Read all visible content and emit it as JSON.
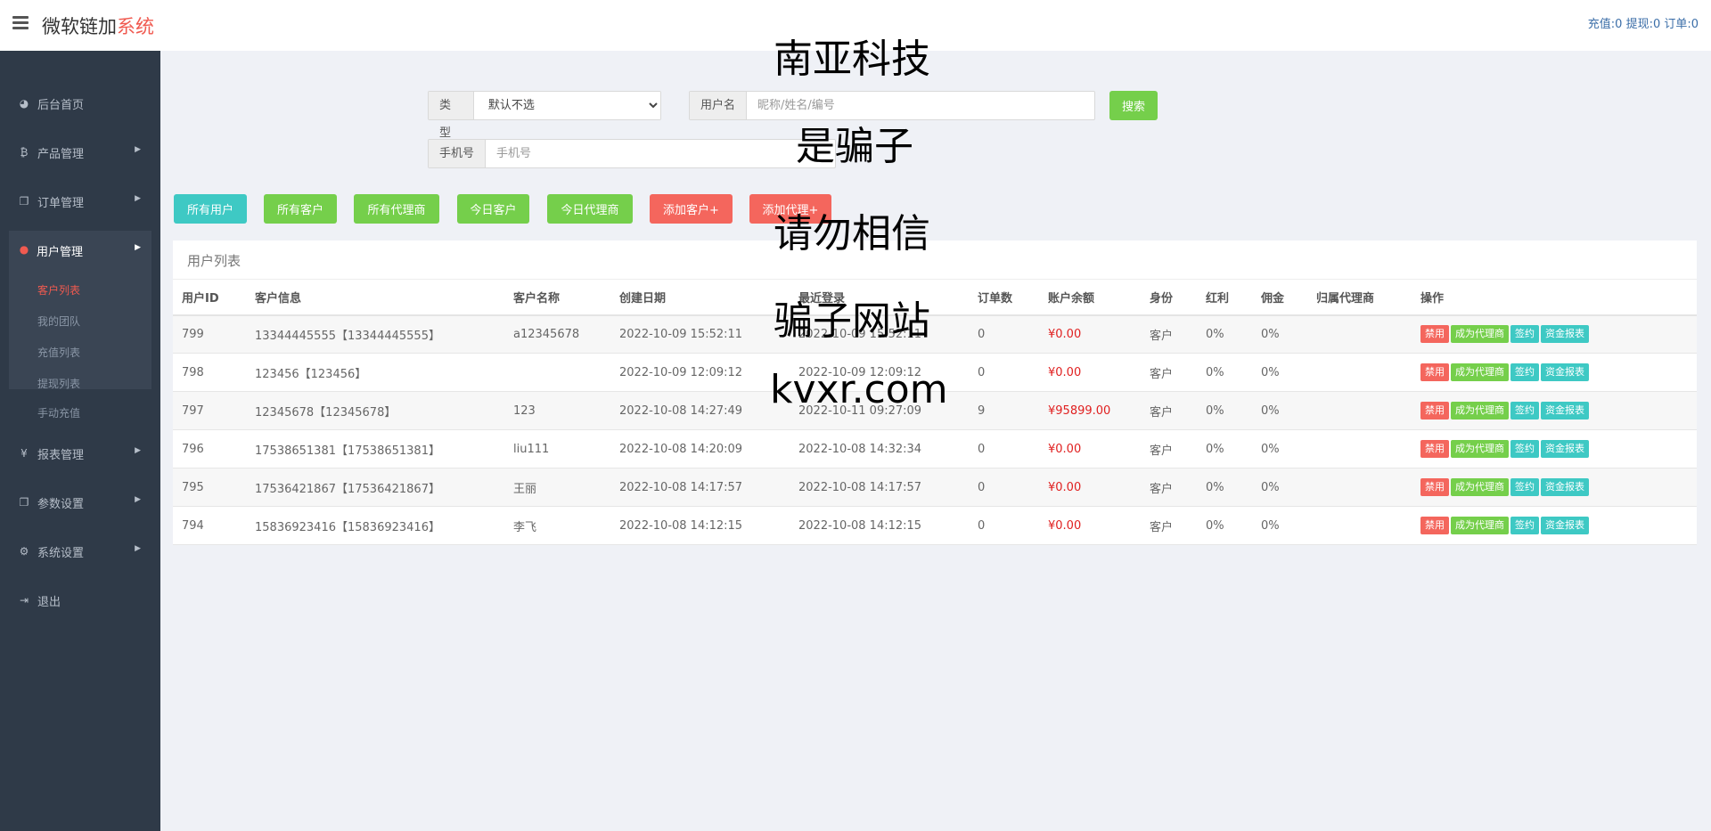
{
  "header": {
    "logo_main": "微软链加",
    "logo_accent": "系统",
    "stats": "充值:0 提现:0 订单:0"
  },
  "sidebar": {
    "items": [
      {
        "label": "后台首页",
        "icon": "dashboard-icon",
        "glyph": "◕"
      },
      {
        "label": "产品管理",
        "icon": "bitcoin-icon",
        "glyph": "₿"
      },
      {
        "label": "订单管理",
        "icon": "copy-icon",
        "glyph": "❐"
      },
      {
        "label": "用户管理",
        "icon": "user-icon",
        "glyph": "👤"
      },
      {
        "label": "报表管理",
        "icon": "yen-icon",
        "glyph": "¥"
      },
      {
        "label": "参数设置",
        "icon": "files-icon",
        "glyph": "❐"
      },
      {
        "label": "系统设置",
        "icon": "gears-icon",
        "glyph": "⚙"
      },
      {
        "label": "退出",
        "icon": "sign-out-icon",
        "glyph": "⇥"
      }
    ],
    "submenu": [
      "客户列表",
      "我的团队",
      "充值列表",
      "提现列表",
      "手动充值"
    ]
  },
  "search": {
    "type_label": "类型",
    "type_selected": "默认不选",
    "username_label": "用户名",
    "username_placeholder": "昵称/姓名/编号",
    "search_button": "搜索",
    "phone_label": "手机号",
    "phone_placeholder": "手机号"
  },
  "filters": {
    "all_users": "所有用户",
    "all_customers": "所有客户",
    "all_agents": "所有代理商",
    "today_customers": "今日客户",
    "today_agents": "今日代理商",
    "add_customer": "添加客户+",
    "add_agent": "添加代理+"
  },
  "table": {
    "title": "用户列表",
    "columns": [
      "用户ID",
      "客户信息",
      "客户名称",
      "创建日期",
      "最近登录",
      "订单数",
      "账户余额",
      "身份",
      "红利",
      "佣金",
      "归属代理商",
      "操作"
    ],
    "actions": [
      "禁用",
      "成为代理商",
      "签约",
      "资金报表"
    ],
    "rows": [
      [
        "799",
        "13344445555【13344445555】",
        "a12345678",
        "2022-10-09 15:52:11",
        "2022-10-09 15:52:11",
        "0",
        "¥0.00",
        "客户",
        "0%",
        "0%",
        ""
      ],
      [
        "798",
        "123456【123456】",
        "",
        "2022-10-09 12:09:12",
        "2022-10-09 12:09:12",
        "0",
        "¥0.00",
        "客户",
        "0%",
        "0%",
        ""
      ],
      [
        "797",
        "12345678【12345678】",
        "123",
        "2022-10-08 14:27:49",
        "2022-10-11 09:27:09",
        "9",
        "¥95899.00",
        "客户",
        "0%",
        "0%",
        ""
      ],
      [
        "796",
        "17538651381【17538651381】",
        "liu111",
        "2022-10-08 14:20:09",
        "2022-10-08 14:32:34",
        "0",
        "¥0.00",
        "客户",
        "0%",
        "0%",
        ""
      ],
      [
        "795",
        "17536421867【17536421867】",
        "王丽",
        "2022-10-08 14:17:57",
        "2022-10-08 14:17:57",
        "0",
        "¥0.00",
        "客户",
        "0%",
        "0%",
        ""
      ],
      [
        "794",
        "15836923416【15836923416】",
        "李飞",
        "2022-10-08 14:12:15",
        "2022-10-08 14:12:15",
        "0",
        "¥0.00",
        "客户",
        "0%",
        "0%",
        ""
      ]
    ]
  },
  "overlay": {
    "line1": "南亚科技",
    "line2": "是骗子",
    "line3": "请勿相信",
    "line4": "骗子网站",
    "line5": "kvxr.com"
  }
}
